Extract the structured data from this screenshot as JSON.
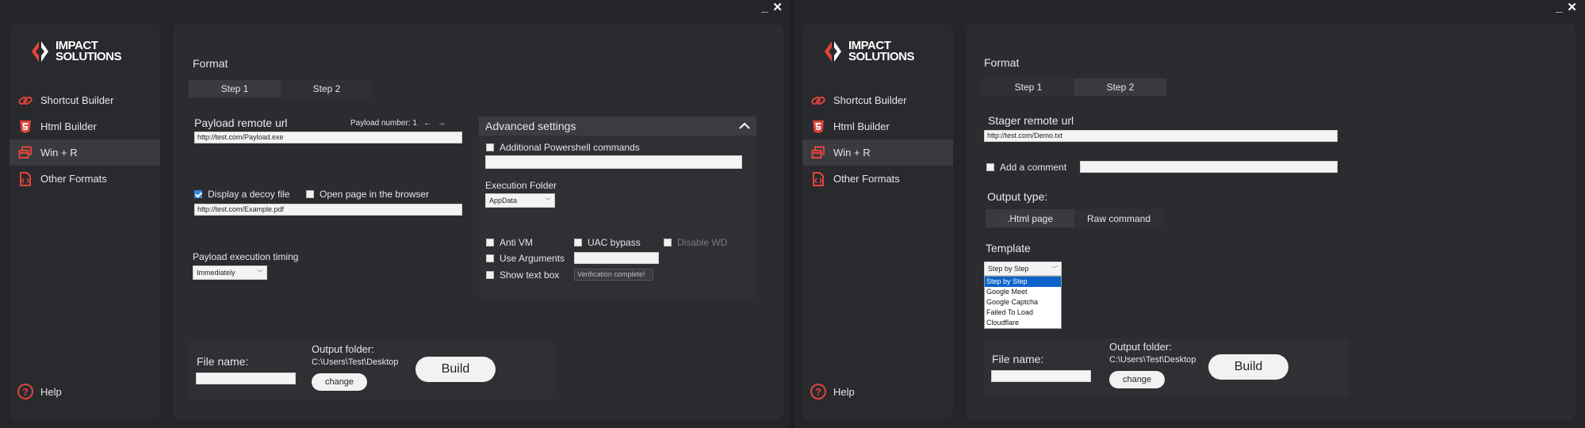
{
  "brand": {
    "line1": "IMPACT",
    "line2": "SOLUTIONS"
  },
  "window_controls": {
    "minimize": "_",
    "close": "✕"
  },
  "nav": [
    {
      "label": "Shortcut Builder",
      "icon": "link-icon"
    },
    {
      "label": "Html Builder",
      "icon": "html5-icon"
    },
    {
      "label": "Win + R",
      "icon": "windows-run-icon"
    },
    {
      "label": "Other Formats",
      "icon": "file-code-icon"
    }
  ],
  "help_label": "Help",
  "help_glyph": "?",
  "left": {
    "format_title": "Format",
    "tabs": [
      "Step 1",
      "Step 2"
    ],
    "active_tab": 0,
    "payload_label": "Payload remote url",
    "payload_number_label": "Payload number: 1",
    "payload_url": "http://test.com/Payload.exe",
    "decoy_label": "Display a decoy file",
    "decoy_checked": true,
    "open_page_label": "Open page in the browser",
    "decoy_url": "http://test.com/Example.pdf",
    "timing_label": "Payload execution timing",
    "timing_value": "Immediately",
    "advanced": {
      "title": "Advanced settings",
      "ps_label": "Additional Powershell commands",
      "exec_folder_label": "Execution Folder",
      "exec_folder_value": "AppData",
      "anti_vm": "Anti VM",
      "uac": "UAC bypass",
      "disable_wd": "Disable WD",
      "use_args": "Use Arguments",
      "show_text": "Show text box",
      "text_value": "Verification complete!"
    },
    "file_name_label": "File name:",
    "output_folder_label": "Output folder:",
    "output_folder_path": "C:\\Users\\Test\\Desktop",
    "change_label": "change",
    "build_label": "Build"
  },
  "right": {
    "format_title": "Format",
    "tabs": [
      "Step 1",
      "Step 2"
    ],
    "active_tab": 1,
    "stager_label": "Stager remote url",
    "stager_url": "http://test.com/Demo.txt",
    "comment_label": "Add a comment",
    "output_type_label": "Output type:",
    "output_types": [
      ".Html page",
      "Raw command"
    ],
    "template_label": "Template",
    "template_value": "Step by Step",
    "template_options": [
      "Step by Step",
      "Google Meet",
      "Google Captcha",
      "Failed To Load",
      "Cloudflare"
    ],
    "file_name_label": "File name:",
    "output_folder_label": "Output folder:",
    "output_folder_path": "C:\\Users\\Test\\Desktop",
    "change_label": "change",
    "build_label": "Build"
  },
  "colors": {
    "accent_red": "#e0453a",
    "checkbox_blue": "#3a86d6",
    "selection_blue": "#0b63c9"
  }
}
